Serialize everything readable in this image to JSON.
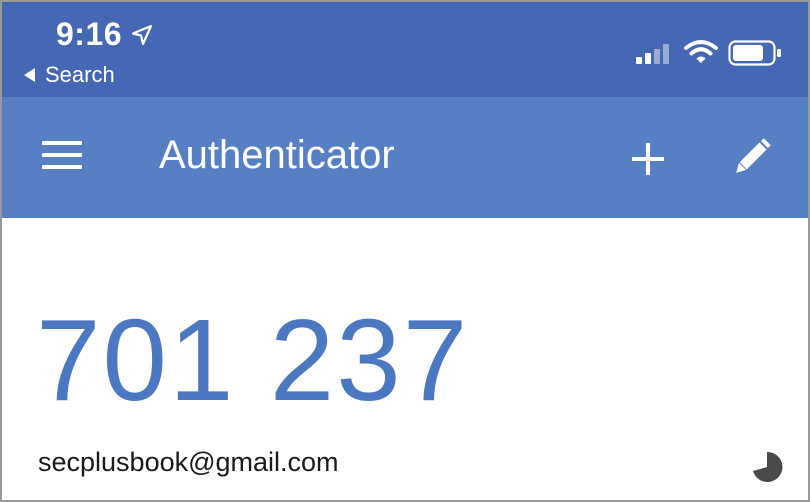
{
  "status_bar": {
    "time": "9:16",
    "back_label": "Search",
    "icons": [
      "location-arrow-icon",
      "cellular-signal-icon",
      "wifi-icon",
      "battery-icon"
    ]
  },
  "app_bar": {
    "title": "Authenticator",
    "icons": [
      "hamburger-menu-icon",
      "plus-icon",
      "pencil-icon"
    ]
  },
  "account": {
    "code": "701 237",
    "email": "secplusbook@gmail.com",
    "timer_icon": "countdown-pie-icon"
  },
  "colors": {
    "status_bar": "#4468b3",
    "app_bar": "#567fc4",
    "code_text": "#4c78c2",
    "timer": "#4a4a4a"
  }
}
